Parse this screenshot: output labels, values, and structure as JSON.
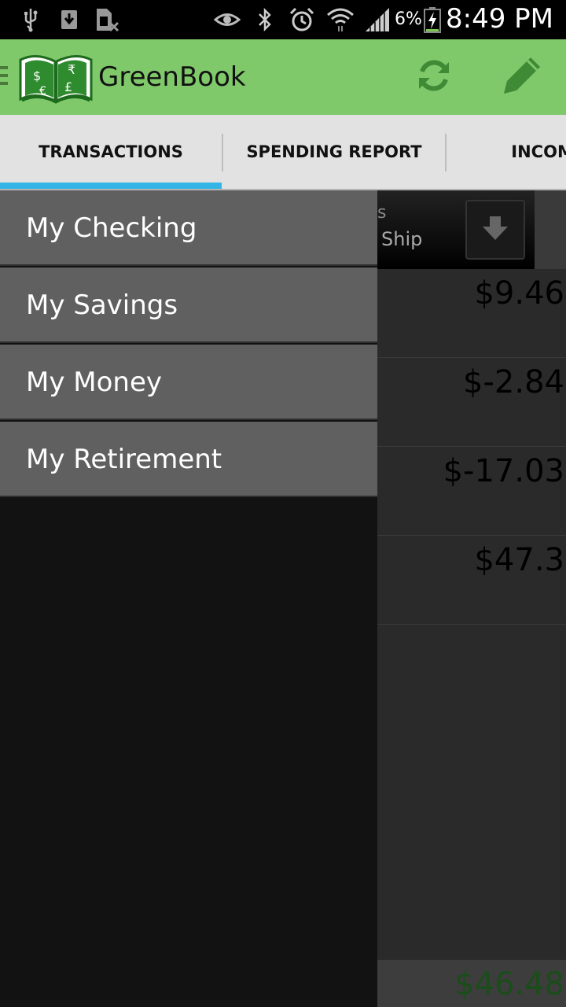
{
  "status_bar": {
    "icons": [
      "usb-icon",
      "download-icon",
      "sim-card-icon",
      "eye-icon",
      "bluetooth-icon",
      "alarm-icon",
      "wifi-icon",
      "signal-icon",
      "battery-charging-icon"
    ],
    "battery_percent": "6%",
    "time": "8:49 PM"
  },
  "action_bar": {
    "title": "GreenBook",
    "color": "#80c96b",
    "actions": [
      "sync-icon",
      "edit-icon"
    ]
  },
  "tabs": [
    {
      "label": "TRANSACTIONS",
      "active": true
    },
    {
      "label": "SPENDING REPORT",
      "active": false
    },
    {
      "label": "INCOME R",
      "active": false
    }
  ],
  "content": {
    "header_category": "s",
    "header_subcategory": "Ship",
    "amounts": [
      "$9.46",
      "$-2.84",
      "$-17.03",
      "$47.3"
    ],
    "total": "$46.48"
  },
  "drawer": {
    "items": [
      "My Checking",
      "My Savings",
      "My Money",
      "My Retirement"
    ]
  }
}
